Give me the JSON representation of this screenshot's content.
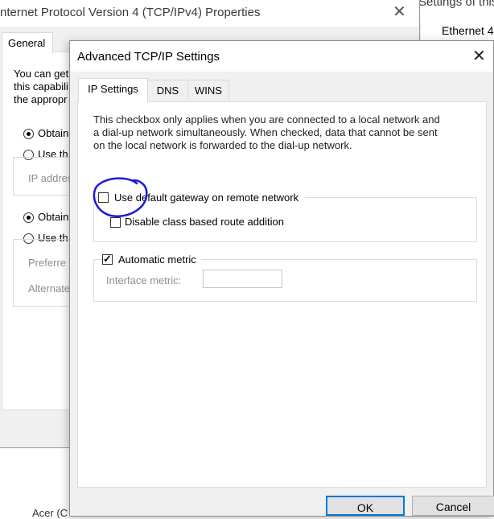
{
  "bg_right": {
    "title_fragment": "Settings of this",
    "item_label": "Ethernet 4"
  },
  "bg_window": {
    "title": "nternet Protocol Version 4 (TCP/IPv4) Properties",
    "tab_general": "General",
    "intro_lines": [
      "You can get",
      "this capabili",
      "the appropr"
    ],
    "radio_obtain_ip": "Obtain",
    "radio_use_ip": "Use th",
    "ip_address_label": "IP addres",
    "radio_obtain_dns": "Obtain",
    "radio_use_dns": "Use th",
    "preferred_label": "Preferre",
    "alternate_label": "Alternate",
    "bottom_item": "Acer (C"
  },
  "dialog": {
    "title": "Advanced TCP/IP Settings",
    "tabs": [
      {
        "label": "IP Settings",
        "active": true
      },
      {
        "label": "DNS",
        "active": false
      },
      {
        "label": "WINS",
        "active": false
      }
    ],
    "description": "This checkbox only applies when you are connected to a local network and a dial-up network simultaneously.  When checked, data that cannot be sent on the local network is forwarded to the dial-up network.",
    "use_default_gateway": {
      "label": "Use default gateway on remote network",
      "checked": false
    },
    "disable_class_route": {
      "label": "Disable class based route addition",
      "checked": false
    },
    "automatic_metric": {
      "label": "Automatic metric",
      "checked": true
    },
    "interface_metric_label": "Interface metric:",
    "interface_metric_value": "",
    "ok_label": "OK",
    "cancel_label": "Cancel"
  },
  "colors": {
    "annotation": "#1a1adb",
    "focus_border": "#0078d7"
  }
}
